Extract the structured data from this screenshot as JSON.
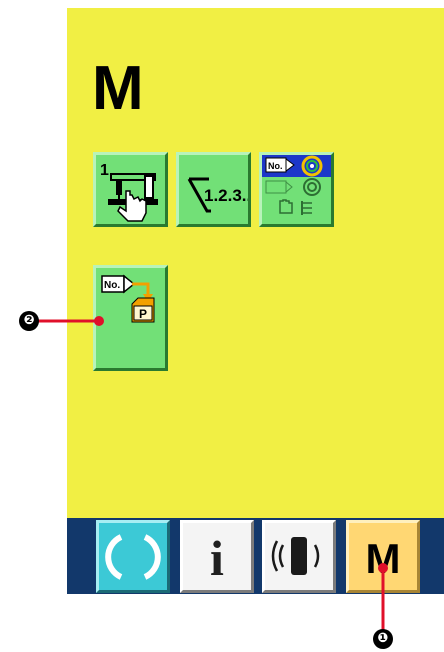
{
  "screen": {
    "mode_title": "M",
    "panel_color": "#f1ef44",
    "button_color": "#72e077"
  },
  "function_buttons": [
    {
      "id": "sewing_machine_settings",
      "icon": "sewing-machine-hand-icon",
      "badge": "1"
    },
    {
      "id": "counter_settings",
      "icon": "counter-icon",
      "label": "1.2.3.."
    },
    {
      "id": "pattern_mode",
      "icon": "pattern-no-spiral-icon",
      "label": "No."
    },
    {
      "id": "pattern_to_p_register",
      "icon": "no-to-p-register-icon",
      "label": "No.",
      "sublabel": "P"
    }
  ],
  "bottom_bar": {
    "color": "#12386b",
    "buttons": [
      {
        "id": "ready",
        "icon": "ready-circle-icon",
        "color": "#3cc9d6"
      },
      {
        "id": "information",
        "icon": "information-icon",
        "label": "i",
        "color": "#f4f4f4"
      },
      {
        "id": "communication",
        "icon": "communication-icon",
        "color": "#f4f4f4"
      },
      {
        "id": "mode",
        "icon": "mode-icon",
        "label": "M",
        "color": "#ffd773"
      }
    ]
  },
  "callouts": [
    {
      "number": "❶",
      "target": "mode"
    },
    {
      "number": "❷",
      "target": "pattern_to_p_register"
    }
  ]
}
